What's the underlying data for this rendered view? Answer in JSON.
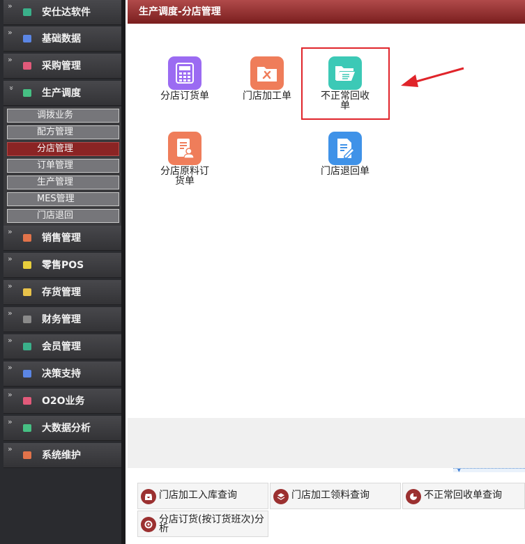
{
  "sidebar": {
    "items": [
      {
        "label": "安仕达软件",
        "icon": "cube-icon",
        "color": "#3ab08a"
      },
      {
        "label": "基础数据",
        "icon": "cube-icon",
        "color": "#5b86e5"
      },
      {
        "label": "采购管理",
        "icon": "cube-icon",
        "color": "#e25a7a"
      },
      {
        "label": "生产调度",
        "icon": "cube-icon",
        "color": "#46c083"
      },
      {
        "label": "销售管理",
        "icon": "cube-icon",
        "color": "#e2734a"
      },
      {
        "label": "零售POS",
        "icon": "cube-icon",
        "color": "#e8cf3c"
      },
      {
        "label": "存货管理",
        "icon": "cube-icon",
        "color": "#e8c24a"
      },
      {
        "label": "财务管理",
        "icon": "cube-icon",
        "color": "#8a8a8a"
      },
      {
        "label": "会员管理",
        "icon": "cube-icon",
        "color": "#3ab08a"
      },
      {
        "label": "决策支持",
        "icon": "cube-icon",
        "color": "#5b86e5"
      },
      {
        "label": "O2O业务",
        "icon": "cube-icon",
        "color": "#e25a7a"
      },
      {
        "label": "大数据分析",
        "icon": "cube-icon",
        "color": "#46c083"
      },
      {
        "label": "系统维护",
        "icon": "cube-icon",
        "color": "#e2734a"
      }
    ],
    "expanded_chevron": "»",
    "submenu": [
      {
        "label": "调拨业务",
        "active": false
      },
      {
        "label": "配方管理",
        "active": false
      },
      {
        "label": "分店管理",
        "active": true
      },
      {
        "label": "订单管理",
        "active": false
      },
      {
        "label": "生产管理",
        "active": false
      },
      {
        "label": "MES管理",
        "active": false
      },
      {
        "label": "门店退回",
        "active": false
      }
    ]
  },
  "header": {
    "title": "生产调度-分店管理"
  },
  "modules": [
    {
      "label": "分店订货单",
      "icon": "calculator-icon",
      "color": "#9b6bf2"
    },
    {
      "label": "门店加工单",
      "icon": "tools-folder-icon",
      "color": "#ef7d5a"
    },
    {
      "label": "不正常回收单",
      "icon": "open-folder-list-icon",
      "color": "#3cc9b6"
    },
    {
      "label": "分店原料订货单",
      "icon": "report-user-icon",
      "color": "#ef7d5a"
    },
    {
      "label": "门店退回单",
      "icon": "edit-document-icon",
      "color": "#3f92e8"
    }
  ],
  "queries": [
    {
      "label": "门店加工入库查询",
      "icon": "inbox-icon"
    },
    {
      "label": "门店加工领料查询",
      "icon": "layers-icon"
    },
    {
      "label": "不正常回收单查询",
      "icon": "pie-chart-icon"
    },
    {
      "label": "分店订货(按订货班次)分析",
      "icon": "lifebuoy-icon"
    }
  ],
  "accent_color": "#8b2424",
  "highlight_color": "#e0242a"
}
